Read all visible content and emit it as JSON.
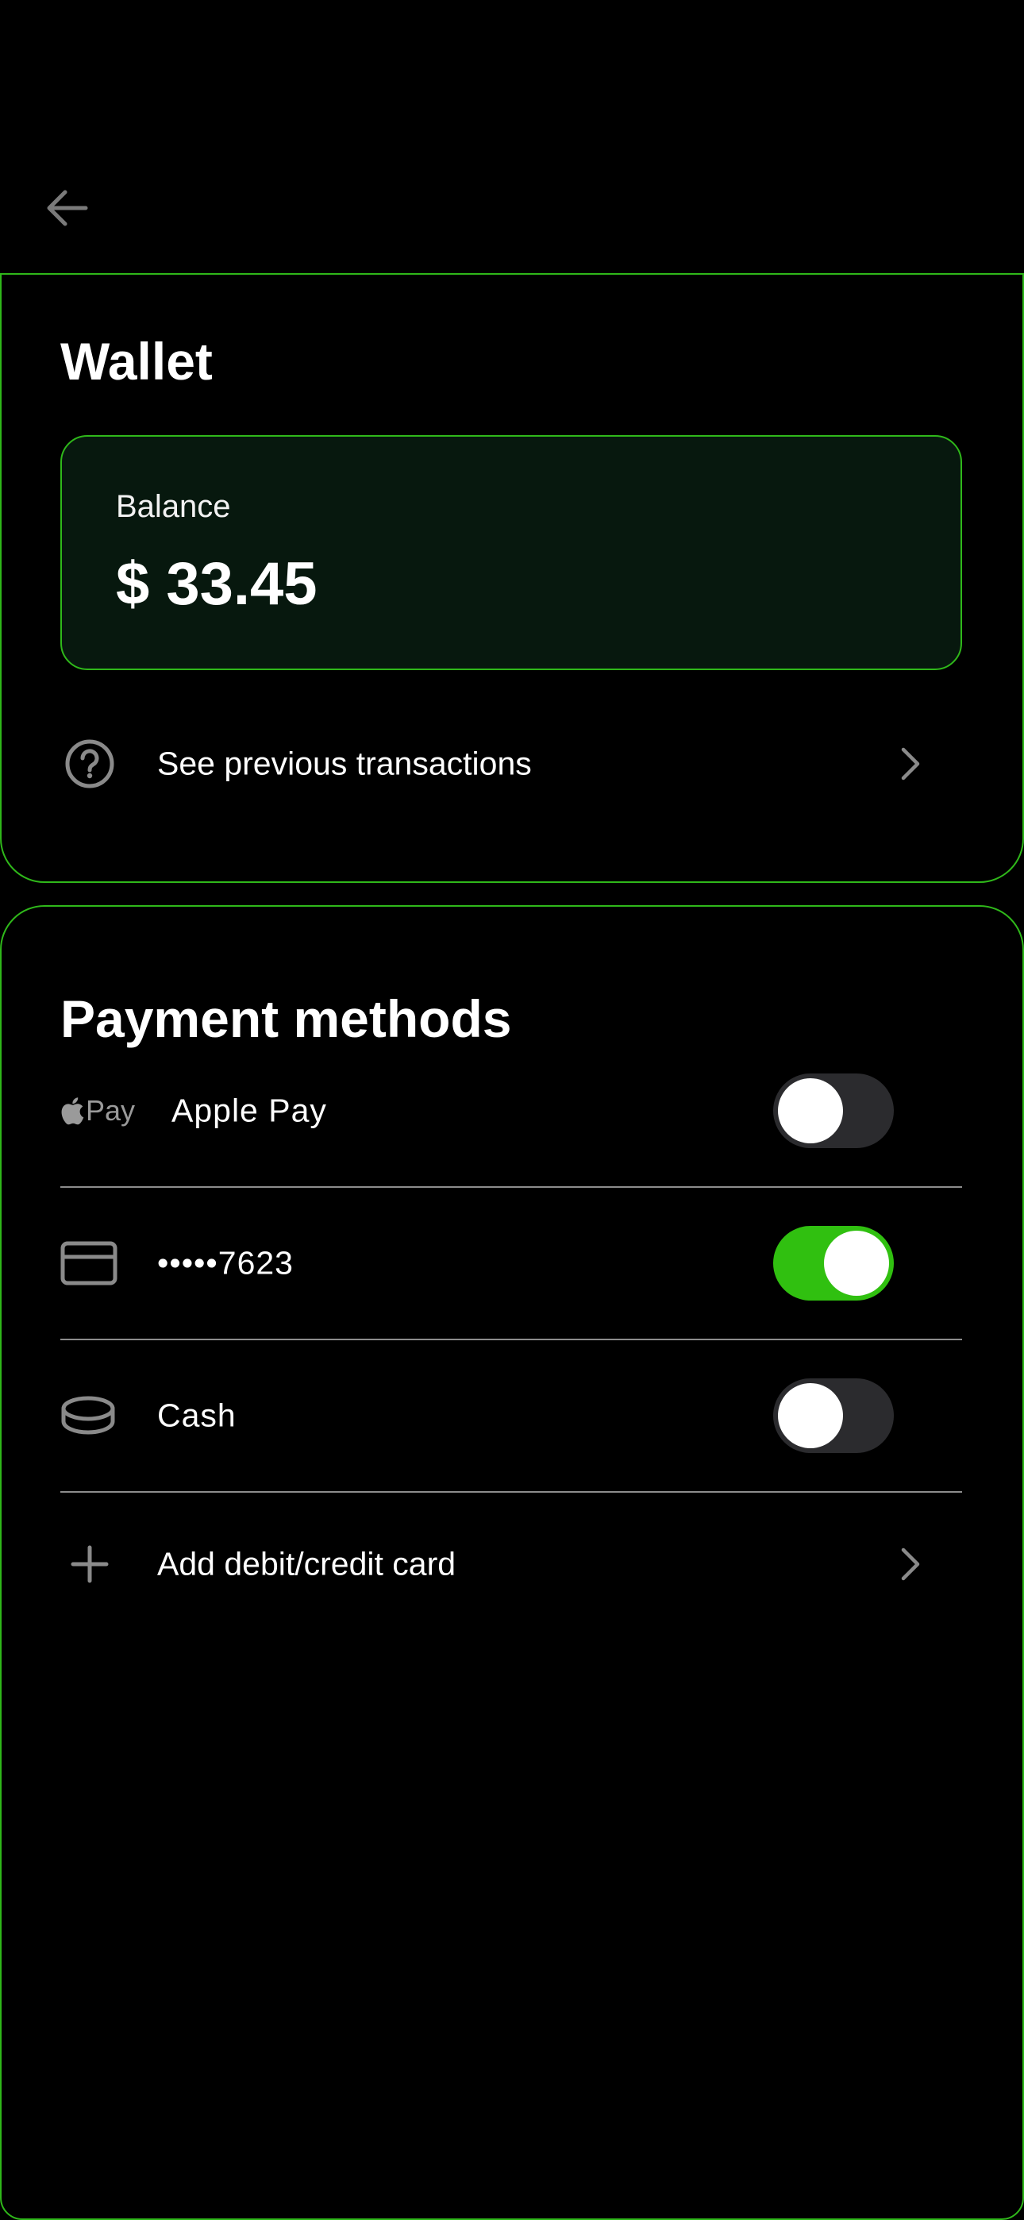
{
  "header": {
    "back_icon": "arrow-left-icon"
  },
  "wallet": {
    "title": "Wallet",
    "balance_label": "Balance",
    "balance_value": "$ 33.45",
    "transactions_icon": "question-circle-icon",
    "transactions_label": "See previous transactions",
    "chevron_icon": "chevron-right-icon"
  },
  "payment": {
    "title": "Payment methods",
    "methods": [
      {
        "icon": "apple-pay-icon",
        "icon_text": "Pay",
        "label": "Apple Pay",
        "enabled": false
      },
      {
        "icon": "credit-card-icon",
        "label": "•••••7623",
        "enabled": true
      },
      {
        "icon": "coin-icon",
        "label": "Cash",
        "enabled": false
      }
    ],
    "add_icon": "plus-icon",
    "add_label": "Add debit/credit card"
  },
  "colors": {
    "accent": "#2fb81a",
    "toggle_on": "#30c010",
    "toggle_off": "#2b2b2e",
    "card_bg": "#07180e",
    "icon_gray": "#8a8a8a"
  }
}
